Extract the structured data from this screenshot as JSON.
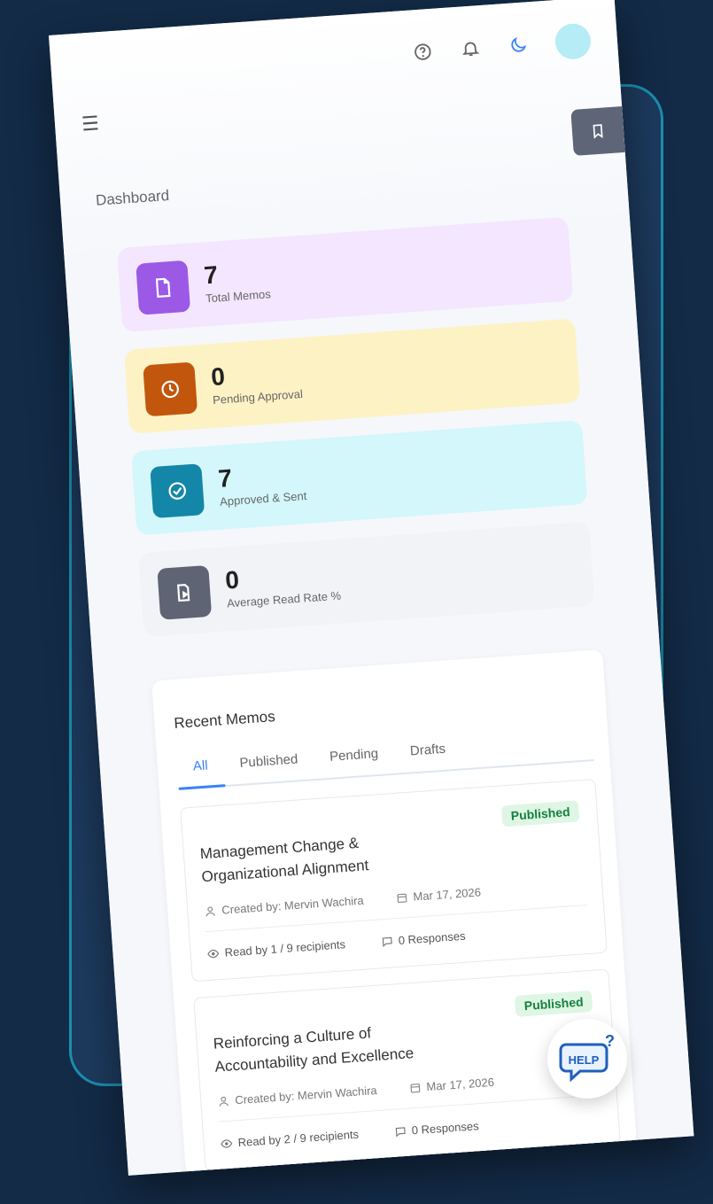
{
  "header": {
    "menu_icon": "hamburger-menu-icon",
    "help_icon": "question-circle-icon",
    "notifications_icon": "bell-icon",
    "theme_icon": "moon-icon",
    "bookmark_icon": "bookmark-icon"
  },
  "page": {
    "title": "Dashboard"
  },
  "stats": [
    {
      "value": "7",
      "label": "Total Memos",
      "icon": "document-icon",
      "bg": "#f4e6fe",
      "icon_bg": "#9b59e6"
    },
    {
      "value": "0",
      "label": "Pending Approval",
      "icon": "clock-icon",
      "bg": "#fdf2c4",
      "icon_bg": "#c2560c"
    },
    {
      "value": "7",
      "label": "Approved & Sent",
      "icon": "check-circle-icon",
      "bg": "#d3f7fb",
      "icon_bg": "#1486a8"
    },
    {
      "value": "0",
      "label": "Average Read Rate %",
      "icon": "read-rate-icon",
      "bg": "#f1f3f6",
      "icon_bg": "#5f6474"
    }
  ],
  "recent": {
    "title": "Recent Memos",
    "tabs": [
      "All",
      "Published",
      "Pending",
      "Drafts"
    ],
    "active_tab": "All",
    "memos": [
      {
        "title": "Management Change & Organizational Alignment",
        "status": "Published",
        "created_by": "Created by: Mervin Wachira",
        "date": "Mar 17, 2026",
        "read": "Read by 1 / 9 recipients",
        "responses": "0 Responses"
      },
      {
        "title": "Reinforcing a Culture of Accountability and Excellence",
        "status": "Published",
        "created_by": "Created by: Mervin Wachira",
        "date": "Mar 17, 2026",
        "read": "Read by 2 / 9 recipients",
        "responses": "0 Responses"
      }
    ]
  },
  "help": {
    "label": "HELP",
    "icon": "help-chat-bubble-icon"
  }
}
